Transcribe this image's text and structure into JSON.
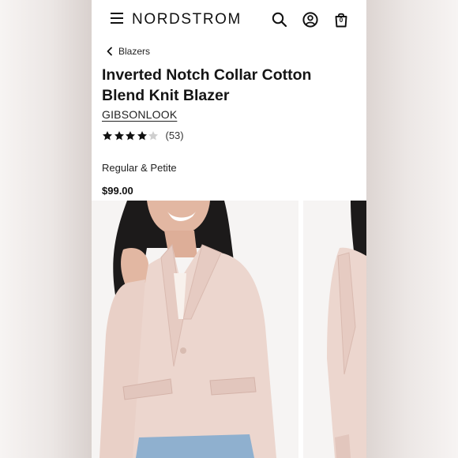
{
  "header": {
    "logo": "NORDSTROM",
    "bag_count": "0"
  },
  "breadcrumb": {
    "label": "Blazers"
  },
  "product": {
    "title": "Inverted Notch Collar Cotton Blend Knit Blazer",
    "brand": "GIBSONLOOK",
    "rating": 4,
    "rating_max": 5,
    "rating_count": "(53)",
    "fit": "Regular & Petite",
    "price": "$99.00"
  },
  "colors": {
    "star_filled": "#111111",
    "star_empty": "#cfcfcf",
    "blazer": "#ecd6ce"
  },
  "icons": [
    "menu-icon",
    "search-icon",
    "account-icon",
    "bag-icon",
    "chevron-left-icon",
    "star-icon"
  ]
}
